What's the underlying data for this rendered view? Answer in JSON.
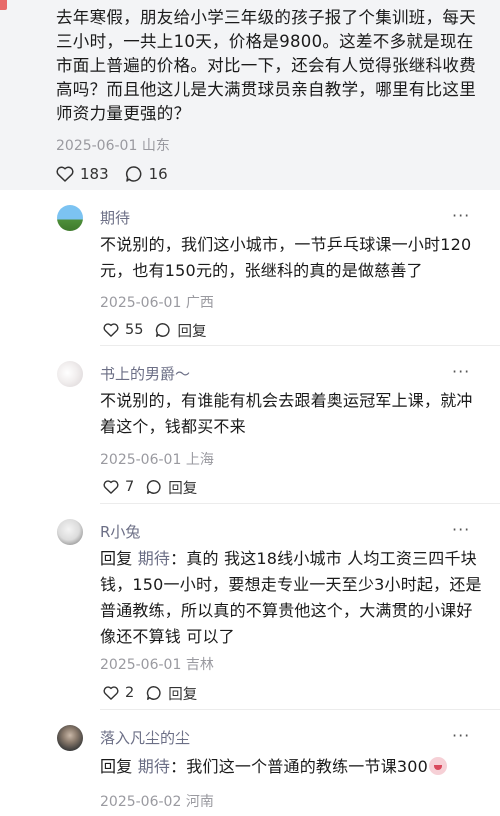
{
  "post": {
    "text": "去年寒假，朋友给小学三年级的孩子报了个集训班，每天三小时，一共上10天，价格是9800。这差不多就是现在市面上普遍的价格。对比一下，还会有人觉得张继科收费高吗？而且他这儿是大满贯球员亲自教学，哪里有比这里师资力量更强的？",
    "date": "2025-06-01",
    "location": "山东",
    "likes": "183",
    "comments": "16"
  },
  "replies": [
    {
      "user": "期待",
      "text": "不说别的，我们这小城市，一节乒乓球课一小时120元，也有150元的，张继科的真的是做慈善了",
      "date": "2025-06-01",
      "location": "广西",
      "likes": "55",
      "reply_label": "回复",
      "avatar_colors": [
        "#7cc3f2",
        "#4e8f3a"
      ]
    },
    {
      "user": "书上的男爵～",
      "text": "不说别的，有谁能有机会去跟着奥运冠军上课，就冲着这个，钱都买不来",
      "date": "2025-06-01",
      "location": "上海",
      "likes": "7",
      "reply_label": "回复",
      "avatar_colors": [
        "#f1eeee",
        "#d8d2d4"
      ]
    },
    {
      "user": "R小兔",
      "reply_prefix": "回复",
      "reply_target": "期待",
      "text": "：真的 我这18线小城市 人均工资三四千块钱，150一小时，要想走专业一天至少3小时起，还是普通教练，所以真的不算贵他这个，大满贯的小课好像还不算钱 可以了",
      "date": "2025-06-01",
      "location": "吉林",
      "likes": "2",
      "reply_label": "回复",
      "avatar_colors": [
        "#e6e6e6",
        "#6b6b6b"
      ]
    },
    {
      "user": "落入凡尘的尘",
      "reply_prefix": "回复",
      "reply_target": "期待",
      "text": "：我们这一个普通的教练一节课300",
      "date": "2025-06-02",
      "location": "河南",
      "avatar_colors": [
        "#3a3a3a",
        "#c9b8a8"
      ]
    }
  ],
  "more_label": "···",
  "icons": {
    "like": "heart-icon",
    "comment": "comment-icon",
    "emoji": "crying-face-emoji"
  },
  "colors": {
    "post_bg": "#f3f4f6",
    "username": "#6c6f86",
    "meta": "#9a9aa0"
  }
}
